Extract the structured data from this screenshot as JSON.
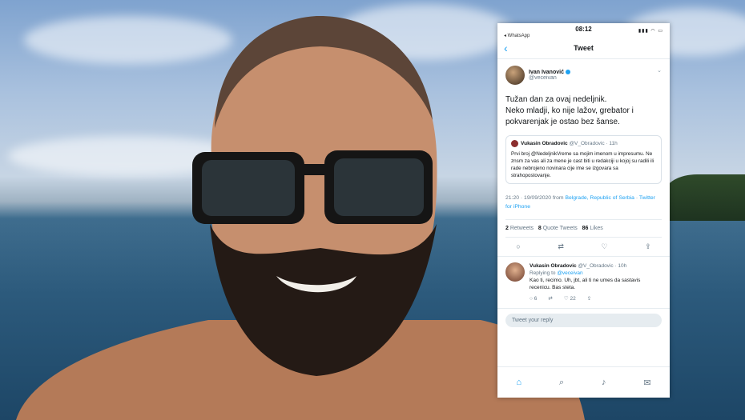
{
  "status_bar": {
    "time": "08:12",
    "carrier": "◂ WhatsApp",
    "system": "▮▮▮ ◠ ▭"
  },
  "nav": {
    "back_icon": "‹",
    "title": "Tweet"
  },
  "tweet": {
    "name": "Ivan Ivanović",
    "handle": "@veceivan",
    "body_lines": [
      "Tužan dan za ovaj nedeljnik.",
      "Neko mladji, ko nije lažov, grebator i",
      "pokvarenjak je ostao bez šanse."
    ],
    "quote": {
      "name": "Vukasin Obradovic",
      "handle": "@V_Obradovic",
      "age": "· 11h",
      "text": "Prvi broj @NedeljnikVreme sa mojim imenom u impresumu. Ne znsm za vas ali za mene je cast biti u redakciji u kojoj su radili ili rade nebrojeno novinara cije ime se izgovara sa strahopostovanje."
    },
    "timestamp": "21:20 · 19/09/2020 from ",
    "location": "Belgrade, Republic of Serbia",
    "separator": " · ",
    "source": "Twitter for iPhone",
    "stats": {
      "retweets_count": "2",
      "retweets_label": " Retweets",
      "quotes_count": "8",
      "quotes_label": " Quote Tweets",
      "likes_count": "86",
      "likes_label": " Likes"
    }
  },
  "reply": {
    "name": "Vukasin Obradovic",
    "handle": "@V_Obradovic · 10h",
    "replying_label": "Replying to ",
    "replying_handle": "@veceivan",
    "text": "Kao ti, recimo. Uh, jbt, ali ti ne umes da sastavis recenicu. Bas steta.",
    "replies": "6",
    "likes": "22"
  },
  "composer": {
    "placeholder": "Tweet your reply"
  }
}
